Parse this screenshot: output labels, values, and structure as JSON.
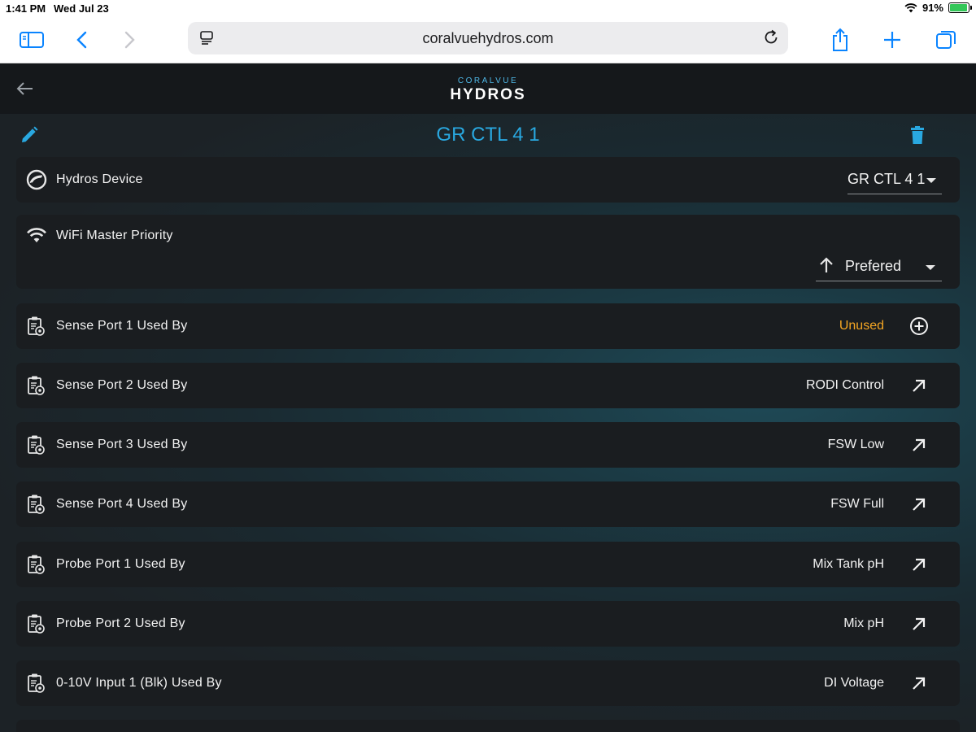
{
  "status_bar": {
    "time": "1:41 PM",
    "date": "Wed Jul 23",
    "battery": "91%"
  },
  "browser": {
    "url": "coralvuehydros.com"
  },
  "app": {
    "brand_small": "CORALVUE",
    "brand_big": "HYDROS"
  },
  "page": {
    "title": "GR CTL 4 1"
  },
  "device_card": {
    "label": "Hydros Device",
    "selected": "GR CTL 4 1"
  },
  "wifi_card": {
    "label": "WiFi Master Priority",
    "selected": "Prefered"
  },
  "ports": [
    {
      "label": "Sense Port 1 Used By",
      "value": "Unused",
      "action": "add-circle-icon"
    },
    {
      "label": "Sense Port 2 Used By",
      "value": "RODI Control",
      "action": "open-arrow-icon"
    },
    {
      "label": "Sense Port 3 Used By",
      "value": "FSW Low",
      "action": "open-arrow-icon"
    },
    {
      "label": "Sense Port 4 Used By",
      "value": "FSW Full",
      "action": "open-arrow-icon"
    },
    {
      "label": "Probe Port 1 Used By",
      "value": "Mix Tank pH",
      "action": "open-arrow-icon"
    },
    {
      "label": "Probe Port 2 Used By",
      "value": "Mix pH",
      "action": "open-arrow-icon"
    },
    {
      "label": "0-10V Input 1 (Blk) Used By",
      "value": "DI Voltage",
      "action": "open-arrow-icon"
    }
  ],
  "colors": {
    "accent": "#29a8e0",
    "unused": "#f5a623",
    "card": "#1a1d20",
    "header": "#15181b"
  }
}
